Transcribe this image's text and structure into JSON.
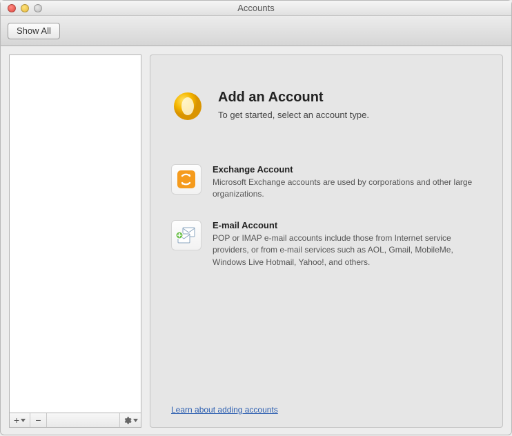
{
  "window": {
    "title": "Accounts"
  },
  "toolbar": {
    "show_all_label": "Show All"
  },
  "hero": {
    "title": "Add an Account",
    "subtitle": "To get started, select an account type."
  },
  "options": {
    "exchange": {
      "title": "Exchange Account",
      "desc": "Microsoft Exchange accounts are used by corporations and other large organizations."
    },
    "email": {
      "title": "E-mail Account",
      "desc": "POP or IMAP e-mail accounts include those from Internet service providers, or from e-mail services such as AOL, Gmail, MobileMe, Windows Live Hotmail, Yahoo!, and others."
    }
  },
  "footer": {
    "learn_link": "Learn about adding accounts"
  },
  "sidebar_controls": {
    "add": "+",
    "remove": "−"
  }
}
